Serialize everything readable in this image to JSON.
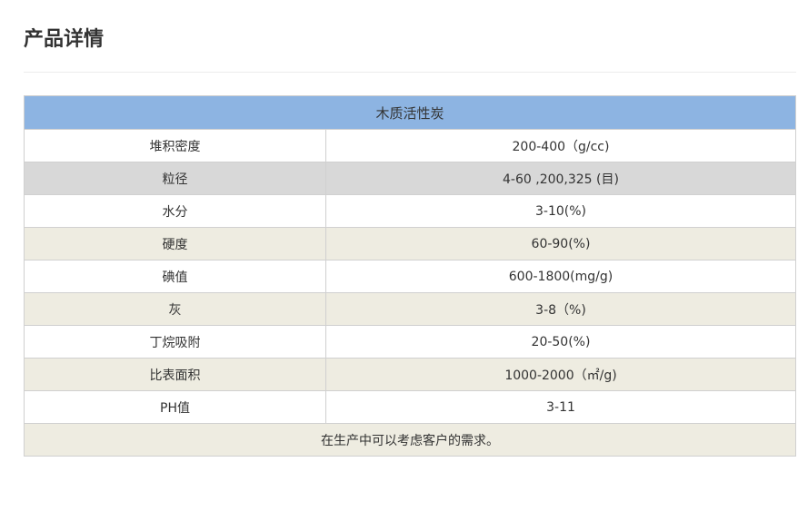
{
  "page": {
    "title": "产品详情"
  },
  "table": {
    "header": "木质活性炭",
    "rows": [
      {
        "label": "堆积密度",
        "value": "200-400（g/cc)",
        "style": "white"
      },
      {
        "label": "粒径",
        "value": "4-60 ,200,325 (目)",
        "style": "gray"
      },
      {
        "label": "水分",
        "value": "3-10(%)",
        "style": "white"
      },
      {
        "label": "硬度",
        "value": "60-90(%)",
        "style": "beige"
      },
      {
        "label": "碘值",
        "value": "600-1800(mg/g)",
        "style": "white"
      },
      {
        "label": "灰",
        "value": "3-8（%)",
        "style": "beige"
      },
      {
        "label": "丁烷吸附",
        "value": "20-50(%)",
        "style": "white"
      },
      {
        "label": "比表面积",
        "value": "1000-2000（㎡/g)",
        "style": "beige"
      },
      {
        "label": "PH值",
        "value": "3-11",
        "style": "white"
      }
    ],
    "footer": "在生产中可以考虑客户的需求。"
  },
  "colors": {
    "header_bg": "#8db4e2",
    "row_gray": "#d8d8d8",
    "row_beige": "#eeece1",
    "border": "#d0d0d0"
  }
}
